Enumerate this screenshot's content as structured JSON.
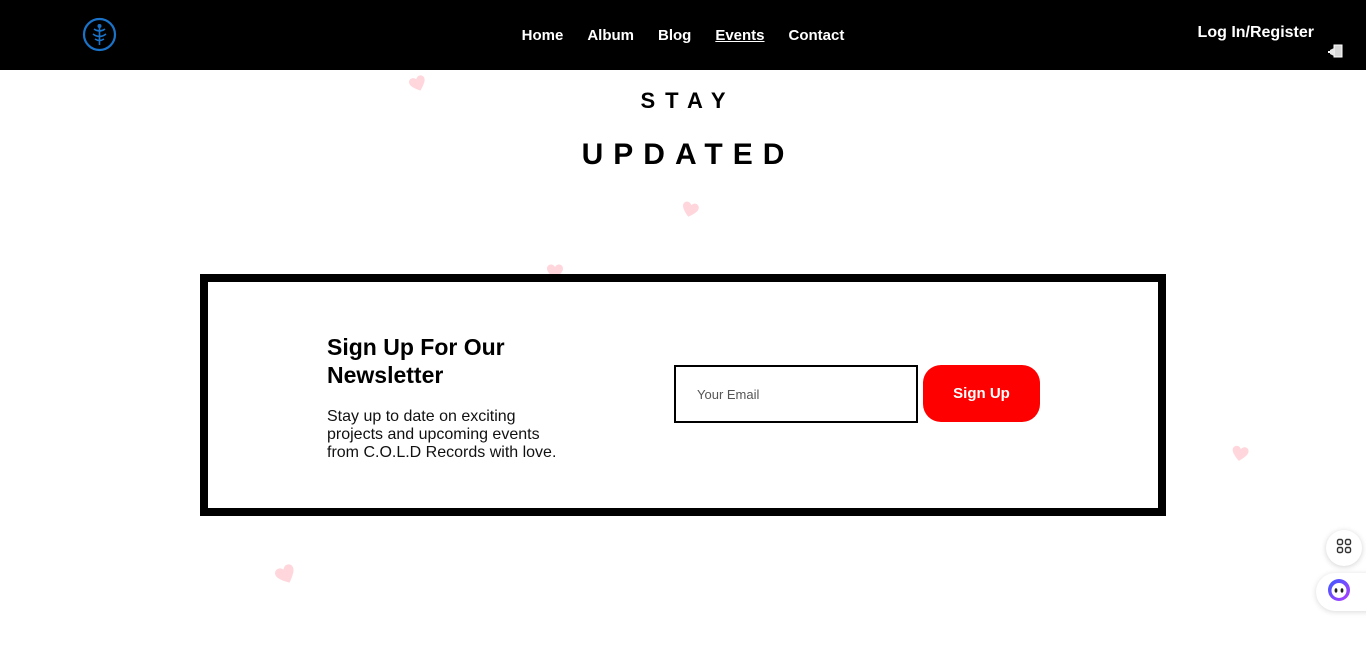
{
  "header": {
    "nav": [
      {
        "label": "Home",
        "active": false
      },
      {
        "label": "Album",
        "active": false
      },
      {
        "label": "Blog",
        "active": false
      },
      {
        "label": "Events",
        "active": true
      },
      {
        "label": "Contact",
        "active": false
      }
    ],
    "login_label": "Log In/Register",
    "logo_color": "#1a73c8"
  },
  "hero": {
    "line1": "STAY",
    "line2": "UPDATED"
  },
  "newsletter": {
    "title": "Sign Up For Our Newsletter",
    "description": "Stay up to date on exciting projects and upcoming events from C.O.L.D Records with love.",
    "email_placeholder": "Your Email",
    "email_value": "",
    "button_label": "Sign Up",
    "button_color": "#ff0000"
  },
  "floating": {
    "apps_icon": "apps-grid-icon",
    "assistant_icon": "assistant-face-icon"
  },
  "colors": {
    "header_bg": "#000000",
    "heart": "#ffd6dc"
  }
}
